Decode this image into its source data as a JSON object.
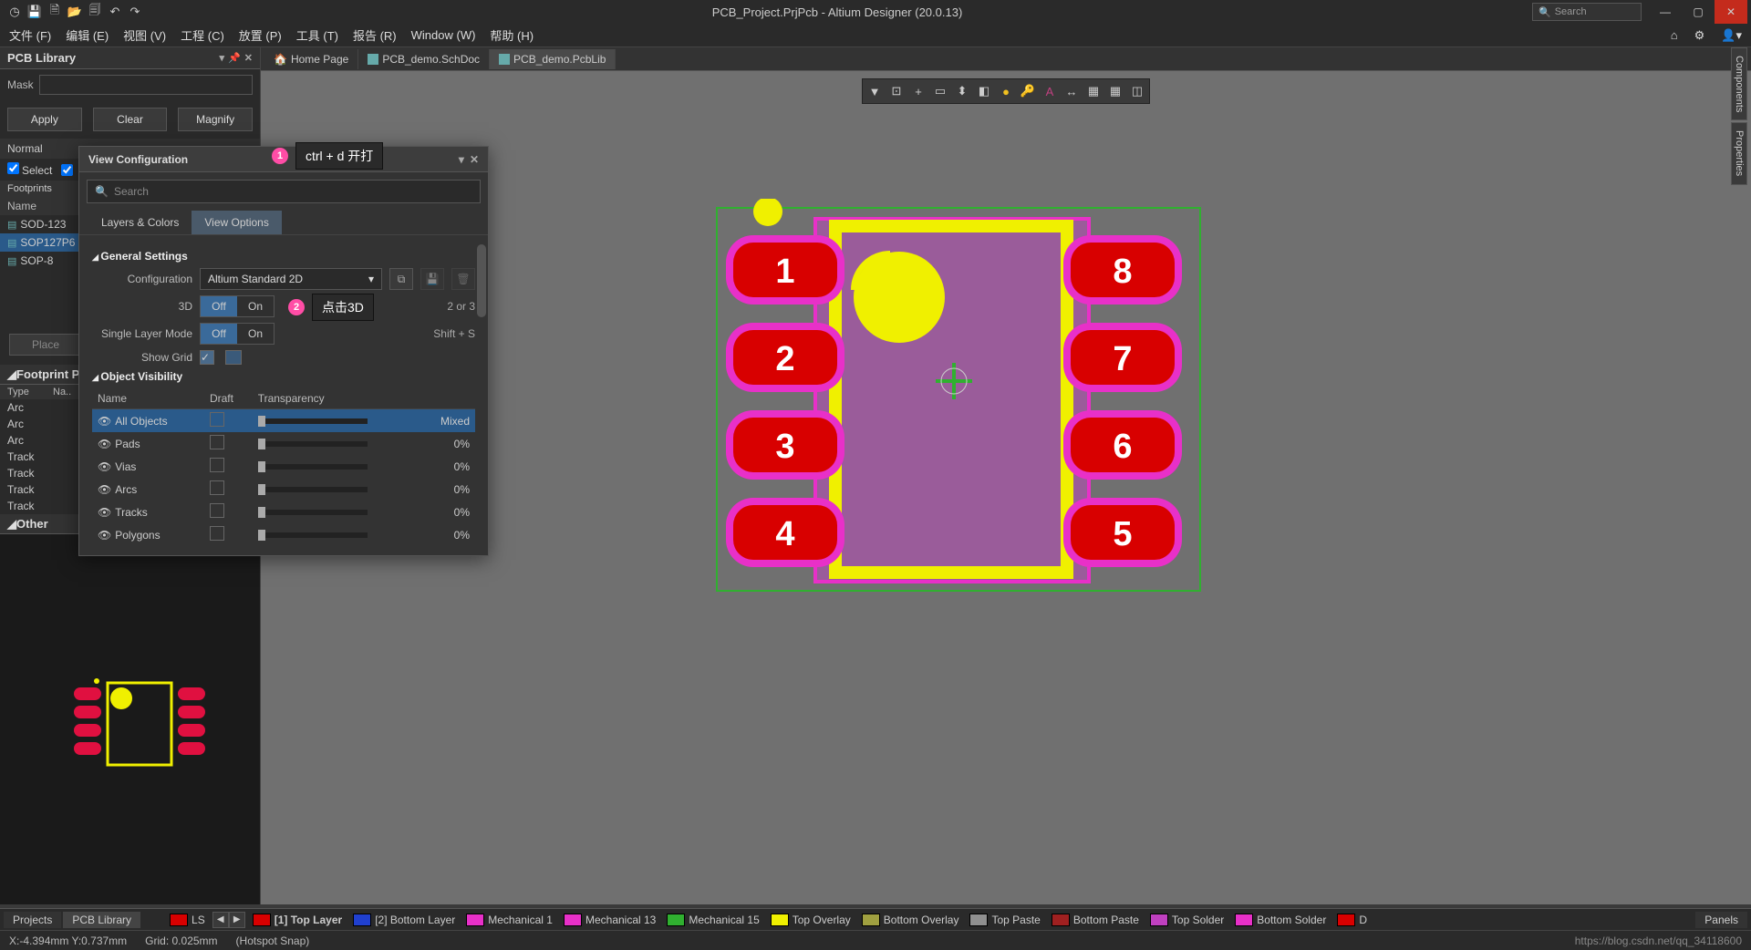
{
  "app": {
    "title": "PCB_Project.PrjPcb - Altium Designer (20.0.13)",
    "search_placeholder": "Search"
  },
  "menus": [
    "文件 (F)",
    "编辑 (E)",
    "视图 (V)",
    "工程 (C)",
    "放置 (P)",
    "工具 (T)",
    "报告 (R)",
    "Window (W)",
    "帮助 (H)"
  ],
  "left_panel": {
    "title": "PCB Library",
    "mask_label": "Mask",
    "apply": "Apply",
    "clear": "Clear",
    "magnify": "Magnify",
    "normal": "Normal",
    "select": "Select",
    "footprints": "Footprints",
    "name_col": "Name",
    "footprint_rows": [
      "SOD-123",
      "SOP127P6",
      "SOP-8"
    ],
    "place": "Place",
    "fp_primitives": "Footprint Pri",
    "prim_cols": [
      "Type",
      "Na.."
    ],
    "prim_rows": [
      "Arc",
      "Arc",
      "Arc",
      "Track",
      "Track",
      "Track",
      "Track"
    ],
    "other": "Other"
  },
  "tabs": [
    {
      "icon": "home",
      "label": "Home Page"
    },
    {
      "icon": "sch",
      "label": "PCB_demo.SchDoc"
    },
    {
      "icon": "pcb",
      "label": "PCB_demo.PcbLib",
      "active": true
    }
  ],
  "right_dock": [
    "Components",
    "Properties"
  ],
  "viewcfg": {
    "title": "View Configuration",
    "search_placeholder": "Search",
    "tabs": [
      "Layers & Colors",
      "View Options"
    ],
    "active_tab": 1,
    "general": "General Settings",
    "config_label": "Configuration",
    "config_value": "Altium Standard 2D",
    "row_3d": "3D",
    "hint_3d": "2 or 3",
    "row_slm": "Single Layer Mode",
    "hint_slm": "Shift + S",
    "show_grid": "Show Grid",
    "off": "Off",
    "on": "On",
    "obj_vis": "Object Visibility",
    "ov_cols": [
      "Name",
      "Draft",
      "Transparency"
    ],
    "ov_rows": [
      {
        "name": "All Objects",
        "val": "Mixed",
        "sel": true
      },
      {
        "name": "Pads",
        "val": "0%"
      },
      {
        "name": "Vias",
        "val": "0%"
      },
      {
        "name": "Arcs",
        "val": "0%"
      },
      {
        "name": "Tracks",
        "val": "0%"
      },
      {
        "name": "Polygons",
        "val": "0%"
      }
    ]
  },
  "annotations": {
    "a1_num": "1",
    "a1_text": "ctrl + d 开打",
    "a2_num": "2",
    "a2_text": "点击3D"
  },
  "layers": {
    "ls": "LS",
    "items": [
      {
        "color": "#d80000",
        "label": "[1] Top Layer",
        "active": true
      },
      {
        "color": "#2040d0",
        "label": "[2] Bottom Layer"
      },
      {
        "color": "#e830c8",
        "label": "Mechanical 1"
      },
      {
        "color": "#e830c8",
        "label": "Mechanical 13"
      },
      {
        "color": "#30b030",
        "label": "Mechanical 15"
      },
      {
        "color": "#f0f000",
        "label": "Top Overlay"
      },
      {
        "color": "#a0a040",
        "label": "Bottom Overlay"
      },
      {
        "color": "#909090",
        "label": "Top Paste"
      },
      {
        "color": "#a02020",
        "label": "Bottom Paste"
      },
      {
        "color": "#c040c0",
        "label": "Top Solder"
      },
      {
        "color": "#e830c8",
        "label": "Bottom Solder"
      },
      {
        "color": "#d80000",
        "label": "D"
      }
    ]
  },
  "bottom_tabs": [
    "Projects",
    "PCB Library"
  ],
  "panels_btn": "Panels",
  "status": {
    "coord": "X:-4.394mm Y:0.737mm",
    "grid": "Grid: 0.025mm",
    "snap": "(Hotspot Snap)",
    "watermark": "https://blog.csdn.net/qq_34118600"
  },
  "pads": [
    "1",
    "2",
    "3",
    "4",
    "5",
    "6",
    "7",
    "8"
  ]
}
